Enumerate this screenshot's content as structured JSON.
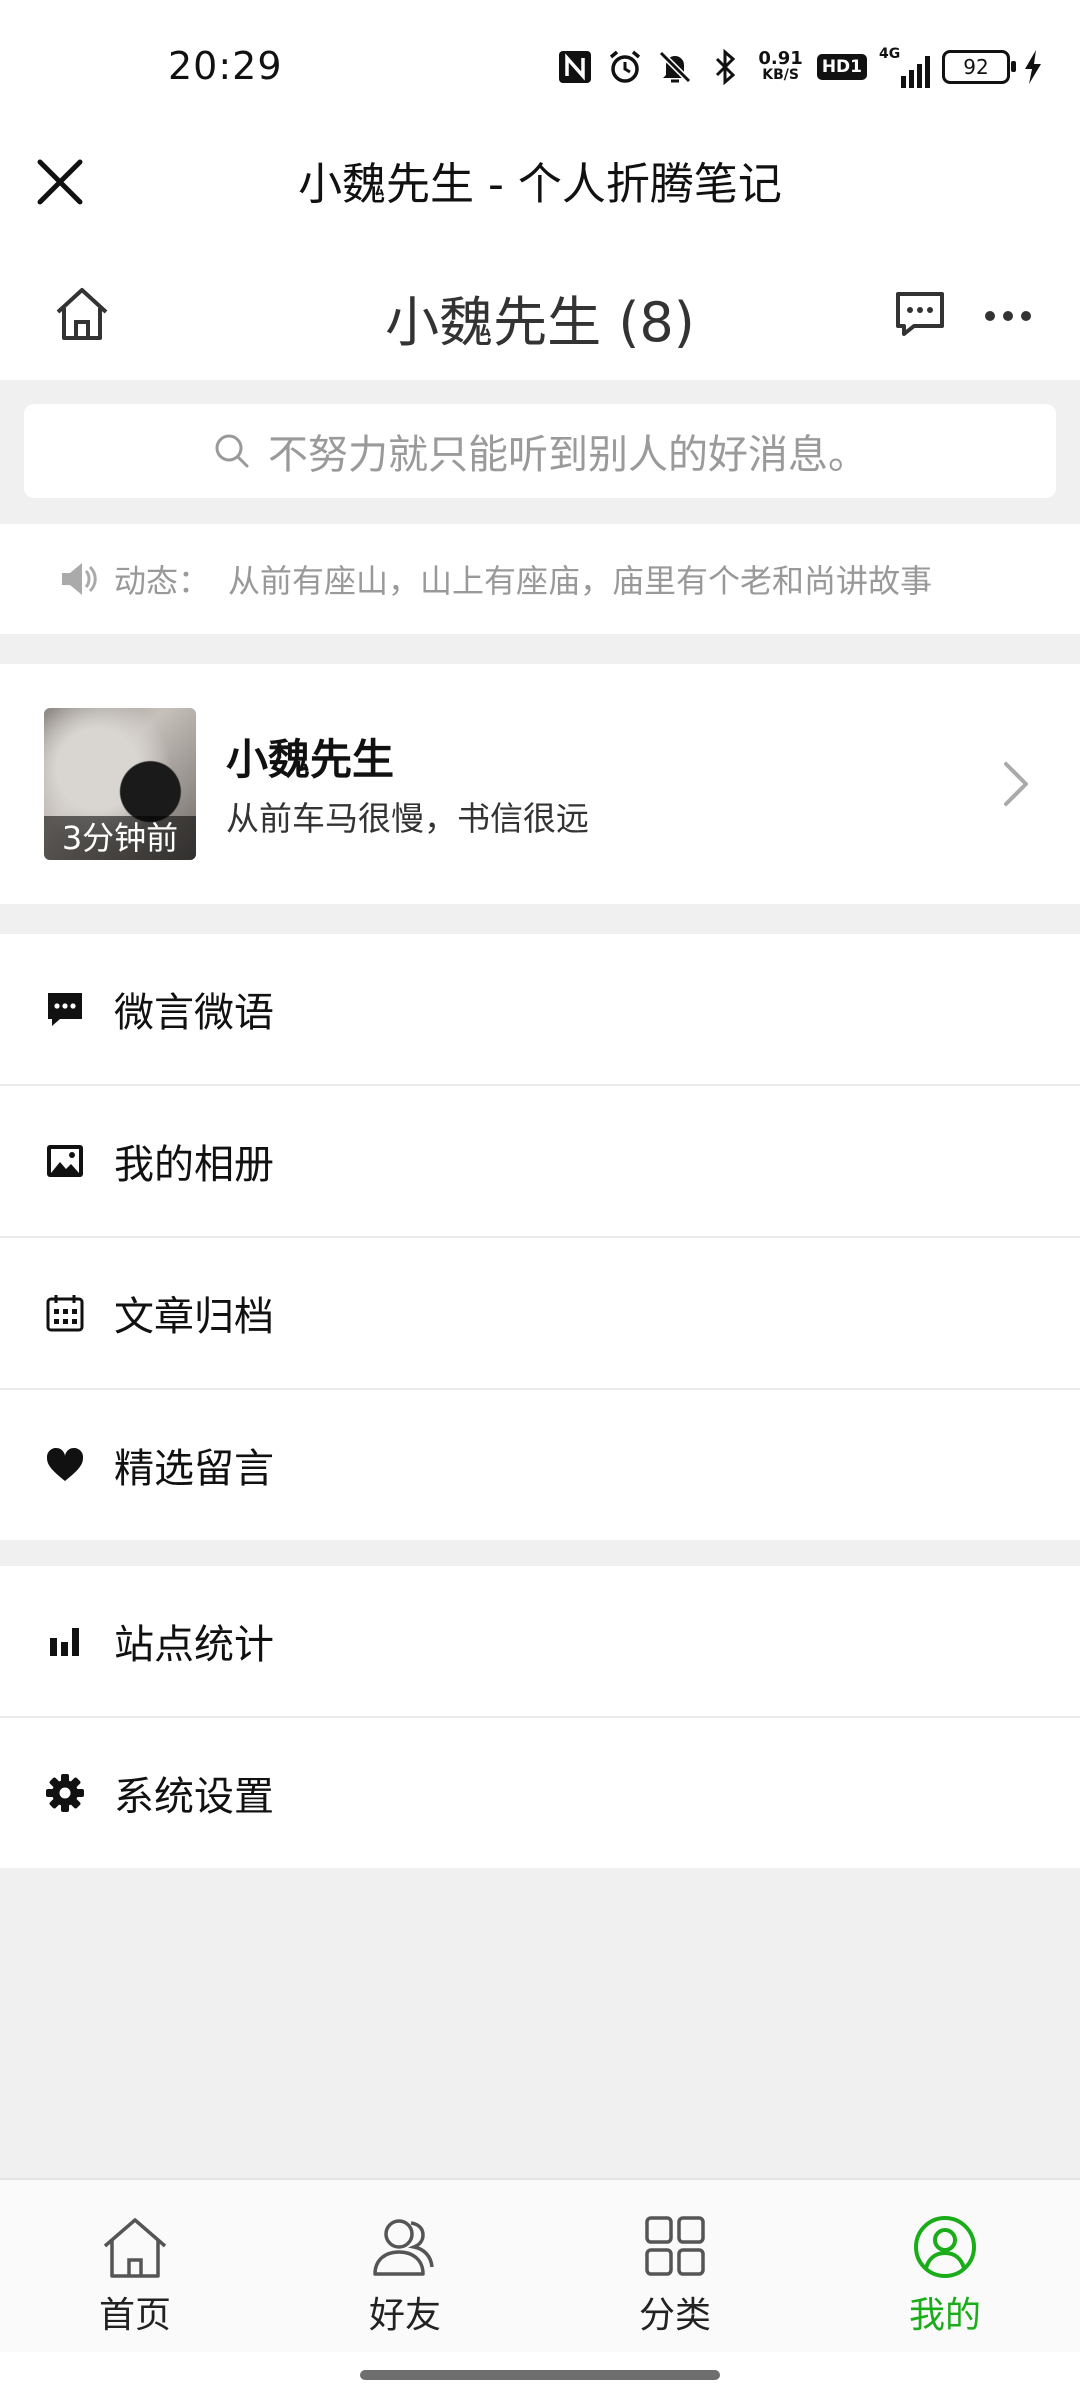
{
  "status_bar": {
    "time": "20:29",
    "speed_value": "0.91",
    "speed_unit": "KB/S",
    "hd_label": "HD1",
    "network_label": "4G",
    "battery_level": "92",
    "icons": [
      "nfc-icon",
      "alarm-icon",
      "mute-icon",
      "bluetooth-icon",
      "signal-icon",
      "battery-icon",
      "charging-icon"
    ]
  },
  "titlebar": {
    "title": "小魏先生 - 个人折腾笔记",
    "close_icon": "close-icon"
  },
  "header": {
    "title": "小魏先生 (8)",
    "left_icon": "home-icon",
    "right_icons": [
      "message-icon",
      "more-icon"
    ]
  },
  "search": {
    "placeholder": "不努力就只能听到别人的好消息。"
  },
  "notice": {
    "label": "动态：",
    "text": "从前有座山，山上有座庙，庙里有个老和尚讲故事"
  },
  "profile": {
    "name": "小魏先生",
    "signature": "从前车马很慢，书信很远",
    "avatar_time": "3分钟前"
  },
  "menu_groups": [
    {
      "items": [
        {
          "label": "微言微语",
          "icon": "chat-icon"
        },
        {
          "label": "我的相册",
          "icon": "image-icon"
        },
        {
          "label": "文章归档",
          "icon": "calendar-icon"
        },
        {
          "label": "精选留言",
          "icon": "heart-icon"
        }
      ]
    },
    {
      "items": [
        {
          "label": "站点统计",
          "icon": "bar-chart-icon"
        },
        {
          "label": "系统设置",
          "icon": "gear-icon"
        }
      ]
    }
  ],
  "bottom_nav": {
    "items": [
      {
        "label": "首页",
        "icon": "home-icon"
      },
      {
        "label": "好友",
        "icon": "friends-icon"
      },
      {
        "label": "分类",
        "icon": "grid-icon"
      },
      {
        "label": "我的",
        "icon": "user-icon",
        "active": true
      }
    ],
    "active_color": "#1aad19"
  }
}
